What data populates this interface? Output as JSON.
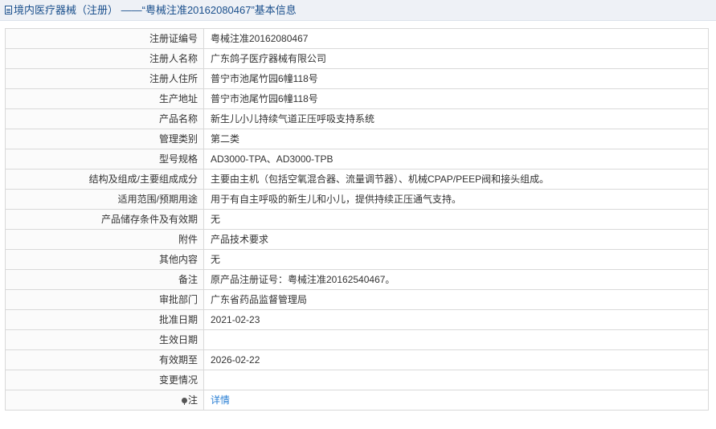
{
  "header": {
    "title": "境内医疗器械（注册） ——“粤械注准20162080467”基本信息"
  },
  "rows": [
    {
      "label": "注册证编号",
      "value": "粤械注准20162080467"
    },
    {
      "label": "注册人名称",
      "value": "广东鸽子医疗器械有限公司"
    },
    {
      "label": "注册人住所",
      "value": "普宁市池尾竹园6幢118号"
    },
    {
      "label": "生产地址",
      "value": "普宁市池尾竹园6幢118号"
    },
    {
      "label": "产品名称",
      "value": "新生儿小儿持续气道正压呼吸支持系统"
    },
    {
      "label": "管理类别",
      "value": "第二类"
    },
    {
      "label": "型号规格",
      "value": "AD3000-TPA、AD3000-TPB"
    },
    {
      "label": "结构及组成/主要组成成分",
      "value": "主要由主机（包括空氧混合器、流量调节器）、机械CPAP/PEEP阀和接头组成。"
    },
    {
      "label": "适用范围/预期用途",
      "value": "用于有自主呼吸的新生儿和小儿，提供持续正压通气支持。"
    },
    {
      "label": "产品储存条件及有效期",
      "value": "无"
    },
    {
      "label": "附件",
      "value": "产品技术要求"
    },
    {
      "label": "其他内容",
      "value": "无"
    },
    {
      "label": "备注",
      "value": "原产品注册证号：粤械注准20162540467。"
    },
    {
      "label": "审批部门",
      "value": "广东省药品监督管理局"
    },
    {
      "label": "批准日期",
      "value": "2021-02-23"
    },
    {
      "label": "生效日期",
      "value": ""
    },
    {
      "label": "有效期至",
      "value": "2026-02-22"
    },
    {
      "label": "变更情况",
      "value": ""
    }
  ],
  "note": {
    "label": "注",
    "link_text": "详情"
  },
  "colors": {
    "title": "#1a4f8c",
    "link": "#2a7fd4",
    "border": "#d9d9d9"
  }
}
